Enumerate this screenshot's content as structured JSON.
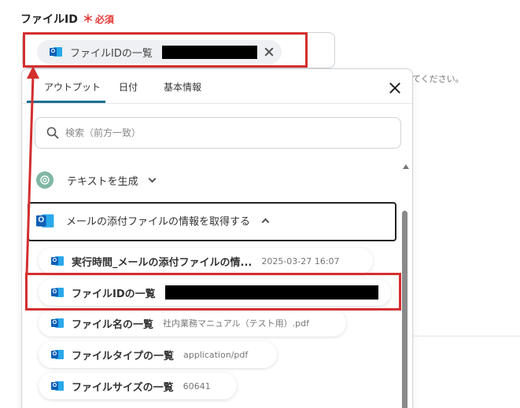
{
  "field": {
    "label": "ファイルID",
    "required_mark": "＊",
    "required_text": "必須",
    "chip_label": "ファイルIDの一覧",
    "chip_icon": "outlook-icon"
  },
  "hint_text": "てください。",
  "dropdown": {
    "tabs": [
      {
        "label": "アウトプット",
        "active": true
      },
      {
        "label": "日付",
        "active": false
      },
      {
        "label": "基本情報",
        "active": false
      }
    ],
    "search": {
      "placeholder": "検索（前方一致）"
    },
    "sections": [
      {
        "title": "テキストを生成",
        "icon": "openai-icon",
        "expanded": false
      },
      {
        "title": "メールの添付ファイルの情報を取得する",
        "icon": "outlook-icon",
        "expanded": true
      }
    ],
    "items": [
      {
        "name": "実行時間_メールの添付ファイルの情...",
        "value": "2025-03-27 16:07"
      },
      {
        "name": "ファイルIDの一覧",
        "value": ""
      },
      {
        "name": "ファイル名の一覧",
        "value": "社内業務マニュアル（テスト用）.pdf"
      },
      {
        "name": "ファイルタイプの一覧",
        "value": "application/pdf"
      },
      {
        "name": "ファイルサイズの一覧",
        "value": "60641"
      }
    ]
  },
  "colors": {
    "highlight": "#d32f2f",
    "required": "#e53935",
    "tab_underline": "#1e6f91",
    "outlook_dark": "#0f5fb5",
    "outlook_light": "#28a8ea",
    "openai_green": "#7fb7a4"
  }
}
